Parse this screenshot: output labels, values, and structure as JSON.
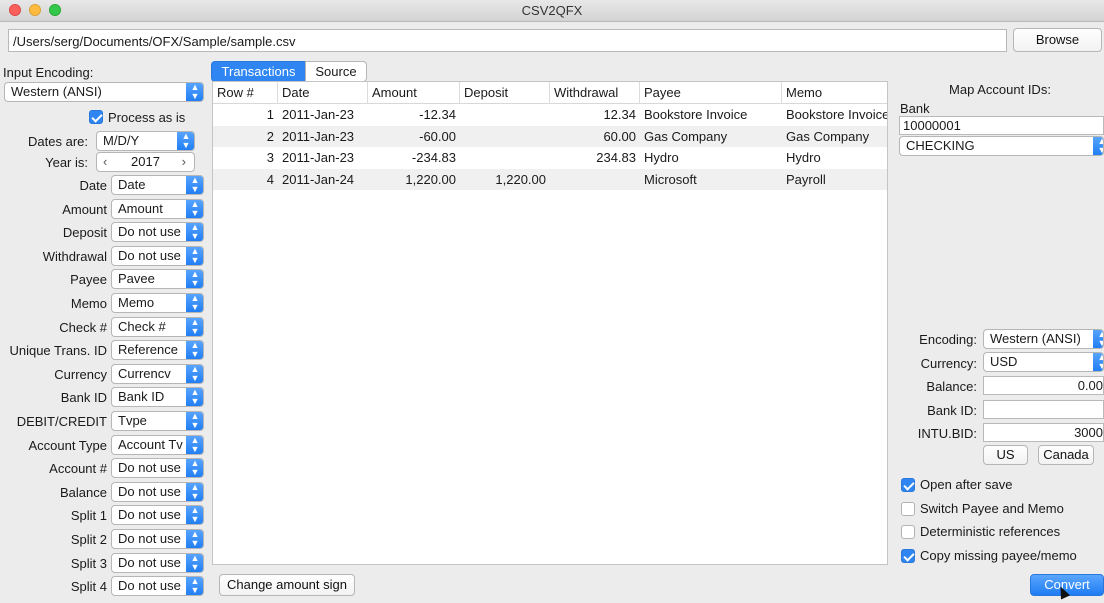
{
  "window": {
    "title": "CSV2QFX"
  },
  "file": {
    "path": "/Users/serg/Documents/OFX/Sample/sample.csv",
    "browse_label": "Browse"
  },
  "left": {
    "input_encoding_label": "Input Encoding:",
    "input_encoding_value": "Western (ANSI)",
    "process_as_is_label": "Process as is",
    "process_as_is_checked": true,
    "dates_are_label": "Dates are:",
    "dates_are_value": "M/D/Y",
    "year_is_label": "Year is:",
    "year_value": "2017",
    "year_prev": "‹",
    "year_next": "›",
    "mappings": [
      {
        "label": "Date",
        "value": "Date"
      },
      {
        "label": "Amount",
        "value": "Amount"
      },
      {
        "label": "Deposit",
        "value": "Do not use"
      },
      {
        "label": "Withdrawal",
        "value": "Do not use"
      },
      {
        "label": "Payee",
        "value": "Pavee"
      },
      {
        "label": "Memo",
        "value": "Memo"
      },
      {
        "label": "Check #",
        "value": "Check #"
      },
      {
        "label": "Unique Trans. ID",
        "value": "Reference"
      },
      {
        "label": "Currency",
        "value": "Currencv"
      },
      {
        "label": "Bank ID",
        "value": "Bank ID"
      },
      {
        "label": "DEBIT/CREDIT",
        "value": "Tvpe"
      },
      {
        "label": "Account Type",
        "value": "Account Tv"
      },
      {
        "label": "Account #",
        "value": "Do not use"
      },
      {
        "label": "Balance",
        "value": "Do not use"
      },
      {
        "label": "Split 1",
        "value": "Do not use"
      },
      {
        "label": "Split 2",
        "value": "Do not use"
      },
      {
        "label": "Split 3",
        "value": "Do not use"
      },
      {
        "label": "Split 4",
        "value": "Do not use"
      }
    ]
  },
  "tabs": [
    {
      "label": "Transactions",
      "active": true
    },
    {
      "label": "Source",
      "active": false
    }
  ],
  "table": {
    "headers": [
      "Row #",
      "Date",
      "Amount",
      "Deposit",
      "Withdrawal",
      "Payee",
      "Memo"
    ],
    "rows": [
      [
        "1",
        "2011-Jan-23",
        "-12.34",
        "",
        "12.34",
        "Bookstore Invoice",
        "Bookstore Invoice"
      ],
      [
        "2",
        "2011-Jan-23",
        "-60.00",
        "",
        "60.00",
        "Gas Company",
        "Gas Company"
      ],
      [
        "3",
        "2011-Jan-23",
        "-234.83",
        "",
        "234.83",
        "Hydro",
        "Hydro"
      ],
      [
        "4",
        "2011-Jan-24",
        "1,220.00",
        "1,220.00",
        "",
        "Microsoft",
        "Payroll"
      ]
    ]
  },
  "change_sign_label": "Change amount sign",
  "right": {
    "map_title": "Map Account IDs:",
    "bank_label": "Bank",
    "account_id": "10000001",
    "account_type": "CHECKING",
    "encoding_label": "Encoding:",
    "encoding_value": "Western (ANSI)",
    "currency_label": "Currency:",
    "currency_value": "USD",
    "balance_label": "Balance:",
    "balance_value": "0.00",
    "bankid_label": "Bank ID:",
    "bankid_value": "",
    "intubid_label": "INTU.BID:",
    "intubid_value": "3000",
    "us_label": "US",
    "canada_label": "Canada",
    "options": [
      {
        "label": "Open after save",
        "checked": true
      },
      {
        "label": "Switch Payee and Memo",
        "checked": false
      },
      {
        "label": "Deterministic references",
        "checked": false
      },
      {
        "label": "Copy missing payee/memo",
        "checked": true
      }
    ],
    "convert_label": "Convert"
  },
  "colors": {
    "accent": "#2f86f3",
    "row_alt": "#f0f0f0"
  }
}
